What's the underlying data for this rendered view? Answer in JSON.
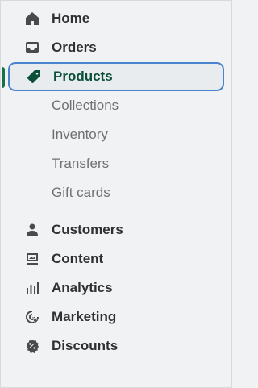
{
  "nav": {
    "items": [
      {
        "label": "Home",
        "icon": "home-icon"
      },
      {
        "label": "Orders",
        "icon": "inbox-icon"
      },
      {
        "label": "Products",
        "icon": "tag-icon",
        "active": true
      },
      {
        "label": "Customers",
        "icon": "person-icon"
      },
      {
        "label": "Content",
        "icon": "image-icon"
      },
      {
        "label": "Analytics",
        "icon": "bar-chart-icon"
      },
      {
        "label": "Marketing",
        "icon": "target-icon"
      },
      {
        "label": "Discounts",
        "icon": "discount-icon"
      }
    ],
    "product_subitems": [
      "Collections",
      "Inventory",
      "Transfers",
      "Gift cards"
    ]
  },
  "colors": {
    "active_text": "#0b4f39",
    "active_border": "#4a84cf",
    "active_indicator": "#16704a",
    "background": "#f1f2f4"
  }
}
